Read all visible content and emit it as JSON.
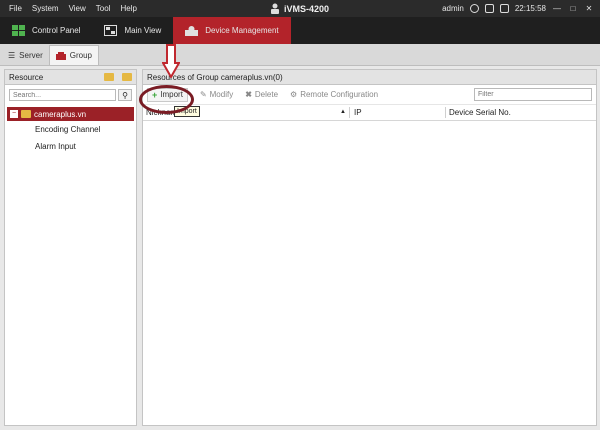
{
  "menubar": {
    "items": [
      "File",
      "System",
      "View",
      "Tool",
      "Help"
    ],
    "app_title": "iVMS-4200",
    "user": "admin",
    "time": "22:15:58"
  },
  "tabs": [
    {
      "label": "Control Panel",
      "icon": "control-panel-icon"
    },
    {
      "label": "Main View",
      "icon": "main-view-icon"
    },
    {
      "label": "Device Management",
      "icon": "device-management-icon",
      "active": true
    }
  ],
  "subtabs": [
    {
      "label": "Server",
      "icon": "list-icon"
    },
    {
      "label": "Group",
      "icon": "group-icon",
      "active": true
    }
  ],
  "left": {
    "header": "Resource",
    "search_placeholder": "Search...",
    "tree_root": "cameraplus.vn",
    "tree_items": [
      "Encoding Channel",
      "Alarm Input"
    ]
  },
  "right": {
    "header": "Resources of Group cameraplus.vn(0)",
    "toolbar": {
      "import": "Import",
      "modify": "Modify",
      "delete": "Delete",
      "remote": "Remote Configuration"
    },
    "filter_placeholder": "Filter",
    "columns": [
      "Nickname",
      "IP",
      "Device Serial No."
    ],
    "tooltip": "Import"
  },
  "colors": {
    "accent": "#b3232a",
    "annotation": "#7a1c24"
  }
}
